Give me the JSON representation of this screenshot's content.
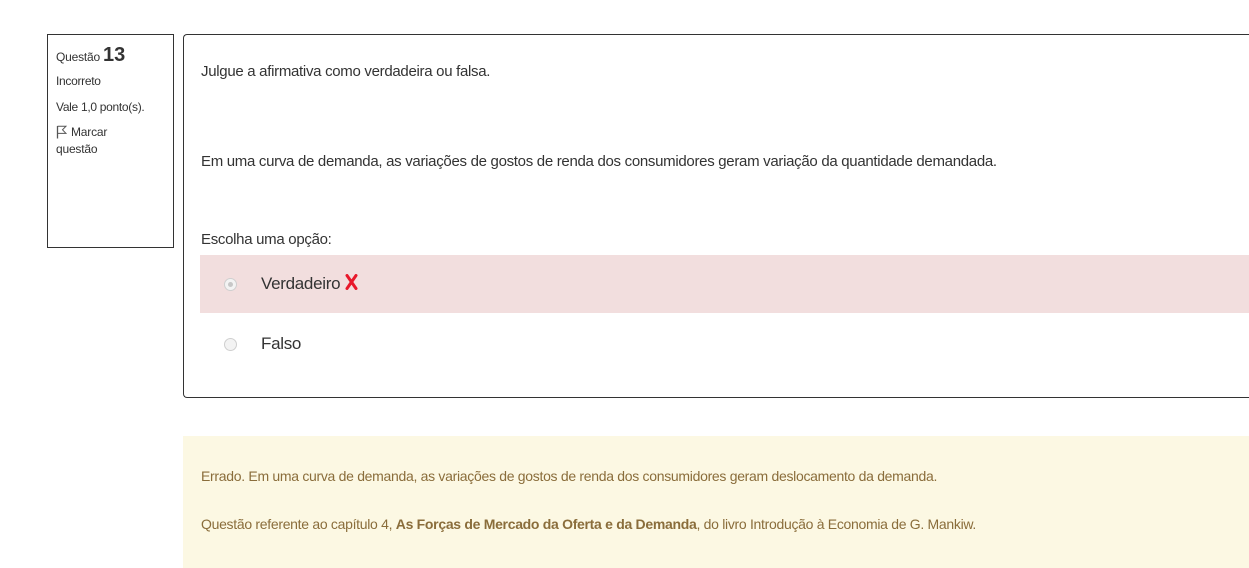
{
  "question_info": {
    "label": "Questão",
    "number": "13",
    "state": "Incorreto",
    "grade": "Vale 1,0 ponto(s).",
    "flag_label_line1": "Marcar",
    "flag_label_line2": "questão"
  },
  "question": {
    "prompt": "Julgue a afirmativa como verdadeira ou falsa.",
    "statement": "Em uma curva de demanda, as variações de gostos de renda dos consumidores geram variação da quantidade demandada.",
    "choose_label": "Escolha uma opção:",
    "options": [
      {
        "label": "Verdadeiro",
        "selected": true,
        "result": "incorrect"
      },
      {
        "label": "Falso",
        "selected": false
      }
    ]
  },
  "feedback": {
    "line1": "Errado. Em uma curva de demanda, as variações de gostos de renda dos consumidores geram deslocamento da demanda.",
    "line2_pre": "Questão referente ao capítulo 4, ",
    "line2_bold": "As Forças de Mercado da Oferta e da Demanda",
    "line2_post": ", do livro Introdução à Economia de G. Mankiw."
  },
  "colors": {
    "incorrect_bg": "#f2dede",
    "incorrect_mark": "#e8182b",
    "feedback_bg": "#fcf8e3",
    "feedback_text": "#8a6d3b"
  }
}
